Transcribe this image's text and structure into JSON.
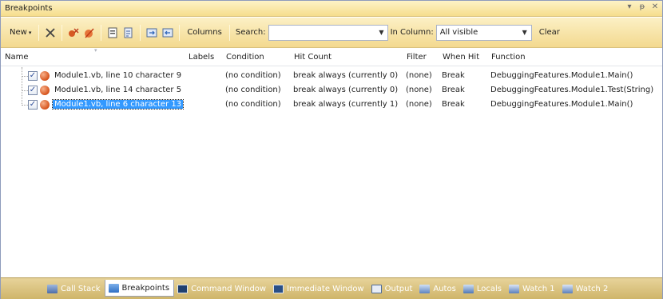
{
  "window": {
    "title": "Breakpoints"
  },
  "title_controls": {
    "dropdown": "▾",
    "pin": "ᵽ",
    "close": "✕"
  },
  "toolbar": {
    "new_label": "New",
    "columns_label": "Columns",
    "search_label": "Search:",
    "search_value": "",
    "in_column_label": "In Column:",
    "in_column_value": "All visible",
    "clear_label": "Clear"
  },
  "columns": {
    "name": "Name",
    "labels": "Labels",
    "condition": "Condition",
    "hit_count": "Hit Count",
    "filter": "Filter",
    "when_hit": "When Hit",
    "function": "Function"
  },
  "rows": [
    {
      "name": "Module1.vb, line 10 character 9",
      "labels": "",
      "condition": "(no condition)",
      "hit_count": "break always (currently 0)",
      "filter": "(none)",
      "when_hit": "Break",
      "function": "DebuggingFeatures.Module1.Main()",
      "checked": true,
      "selected": false
    },
    {
      "name": "Module1.vb, line 14 character 5",
      "labels": "",
      "condition": "(no condition)",
      "hit_count": "break always (currently 0)",
      "filter": "(none)",
      "when_hit": "Break",
      "function": "DebuggingFeatures.Module1.Test(String)",
      "checked": true,
      "selected": false
    },
    {
      "name": "Module1.vb, line 6 character 13",
      "labels": "",
      "condition": "(no condition)",
      "hit_count": "break always (currently 1)",
      "filter": "(none)",
      "when_hit": "Break",
      "function": "DebuggingFeatures.Module1.Main()",
      "checked": true,
      "selected": true
    }
  ],
  "bottom_tabs": [
    {
      "label": "Call Stack",
      "icon": "call-stack-icon",
      "active": false
    },
    {
      "label": "Breakpoints",
      "icon": "breakpoints-icon",
      "active": true
    },
    {
      "label": "Command Window",
      "icon": "command-window-icon",
      "active": false
    },
    {
      "label": "Immediate Window",
      "icon": "immediate-window-icon",
      "active": false
    },
    {
      "label": "Output",
      "icon": "output-icon",
      "active": false
    },
    {
      "label": "Autos",
      "icon": "autos-icon",
      "active": false
    },
    {
      "label": "Locals",
      "icon": "locals-icon",
      "active": false
    },
    {
      "label": "Watch 1",
      "icon": "watch-icon",
      "active": false
    },
    {
      "label": "Watch 2",
      "icon": "watch-icon",
      "active": false
    }
  ],
  "colors": {
    "title_bar": "#f6dd8c",
    "selection": "#3399ff",
    "bottom_bar": "#cfb56a"
  }
}
